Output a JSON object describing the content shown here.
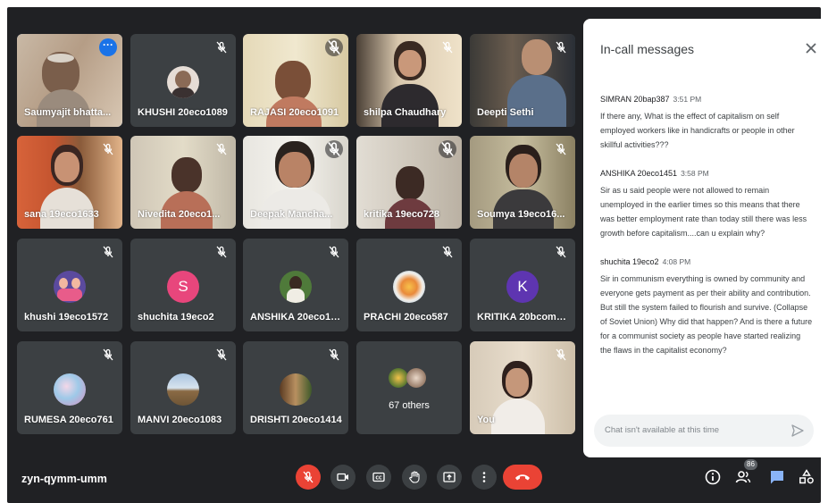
{
  "colors": {
    "background": "#202124",
    "tile": "#3c4043",
    "accent": "#1a73e8",
    "danger": "#ea4335",
    "chat_icon": "#8ab4f8"
  },
  "meeting": {
    "code": "zyn-qymm-umm"
  },
  "participants": [
    {
      "name": "Saumyajit bhatta...",
      "muted": false,
      "video": true,
      "selected": true
    },
    {
      "name": "KHUSHI 20eco1089",
      "muted": true,
      "video": false
    },
    {
      "name": "RAJASI 20eco1091",
      "muted": true,
      "video": true
    },
    {
      "name": "shilpa Chaudhary",
      "muted": true,
      "video": true
    },
    {
      "name": "Deepti Sethi",
      "muted": true,
      "video": true
    },
    {
      "name": "sana 19eco1633",
      "muted": true,
      "video": true
    },
    {
      "name": "Nivedita 20eco1...",
      "muted": true,
      "video": true
    },
    {
      "name": "Deepak Mancha...",
      "muted": true,
      "video": true
    },
    {
      "name": "kritika 19eco728",
      "muted": true,
      "video": true
    },
    {
      "name": "Soumya 19eco16...",
      "muted": true,
      "video": true
    },
    {
      "name": "khushi 19eco1572",
      "muted": true,
      "video": false
    },
    {
      "name": "shuchita 19eco2",
      "muted": true,
      "video": false,
      "initial": "S"
    },
    {
      "name": "ANSHIKA 20eco14...",
      "muted": true,
      "video": false
    },
    {
      "name": "PRACHI 20eco587",
      "muted": true,
      "video": false
    },
    {
      "name": "KRITIKA 20bcomh...",
      "muted": true,
      "video": false,
      "initial": "K"
    },
    {
      "name": "RUMESA 20eco761",
      "muted": true,
      "video": false
    },
    {
      "name": "MANVI 20eco1083",
      "muted": true,
      "video": false
    },
    {
      "name": "DRISHTI 20eco1414",
      "muted": true,
      "video": false
    },
    {
      "name": "67 others",
      "muted": false,
      "video": false
    },
    {
      "name": "You",
      "muted": true,
      "video": true
    }
  ],
  "panel": {
    "title": "In-call messages",
    "close_icon": "close-icon",
    "messages": [
      {
        "sender": "SIMRAN 20bap387",
        "time": "3:51 PM",
        "text": "If there any, What is the effect of capitalism on self employed workers like in handicrafts or people in other skillful activities???"
      },
      {
        "sender": "ANSHIKA 20eco1451",
        "time": "3:58 PM",
        "text": "Sir as u said people were not allowed to remain unemployed in the earlier times so this means that there was better employment rate than today still there was less growth before capitalism....can u explain why?"
      },
      {
        "sender": "shuchita 19eco2",
        "time": "4:08 PM",
        "text": "Sir in communism everything is owned by community and everyone gets payment as per their ability and contribution. But still the system failed to flourish and survive. (Collapse of Soviet Union) Why did that happen? And is there a future for a communist society as people have started realizing the flaws in the capitalist economy?"
      }
    ],
    "input_placeholder": "Chat isn't available at this time"
  },
  "controls": {
    "people_count": "86",
    "buttons": [
      "mic-off-icon",
      "camera-icon",
      "captions-icon",
      "raise-hand-icon",
      "present-icon",
      "more-options-icon",
      "hang-up-icon"
    ],
    "right": [
      "info-icon",
      "people-icon",
      "chat-icon",
      "activities-icon"
    ]
  }
}
